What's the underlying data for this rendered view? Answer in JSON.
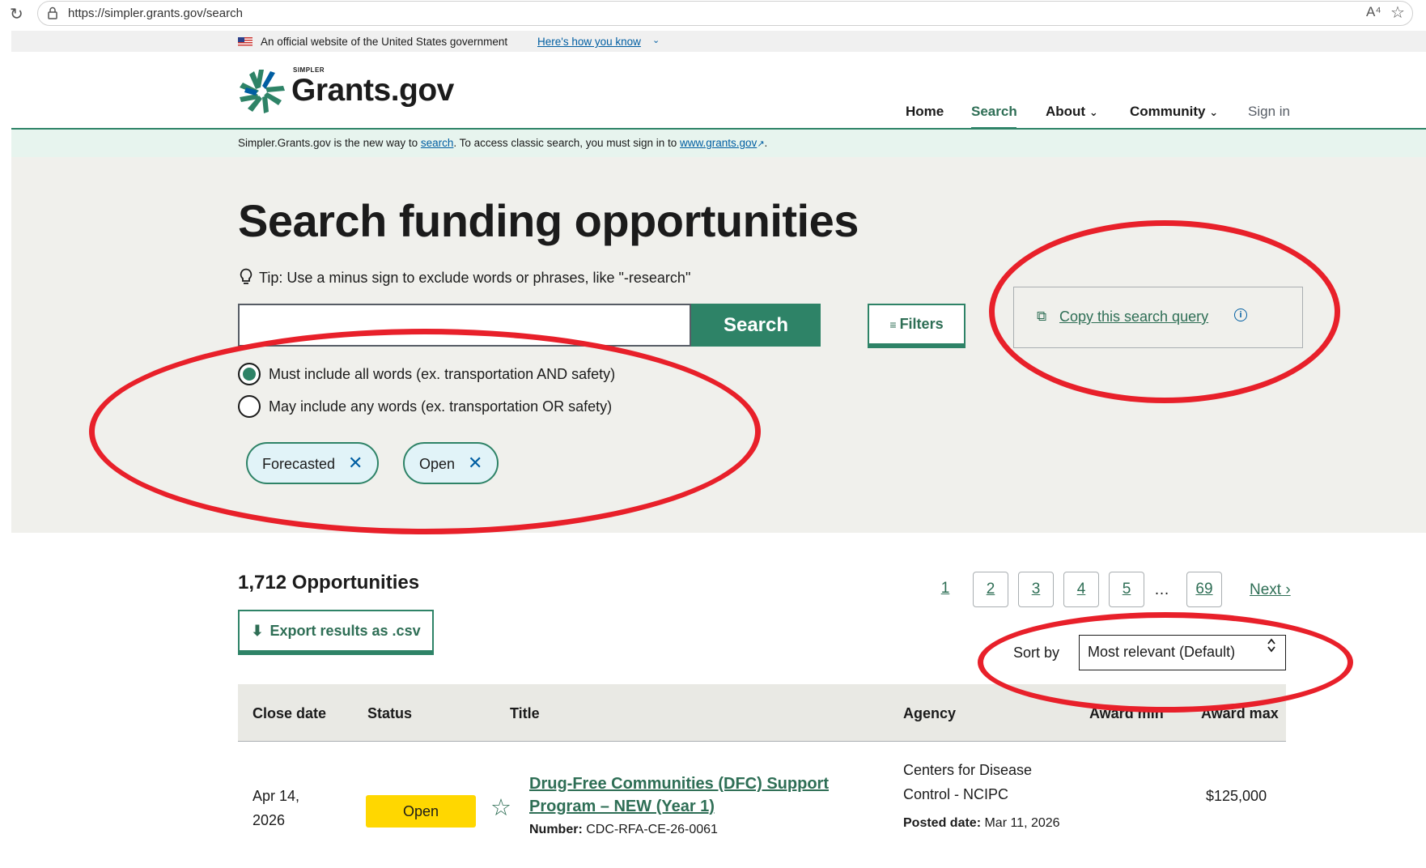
{
  "browser": {
    "url": "https://simpler.grants.gov/search",
    "reload_glyph": "↻",
    "read_aloud_glyph": "A⁴",
    "favorite_glyph": "☆"
  },
  "gov_banner": {
    "text": "An official website of the United States government",
    "link": "Here's how you know",
    "chevron": "⌄"
  },
  "header": {
    "logo_small": "SIMPLER",
    "logo_text": "Grants.gov",
    "nav": [
      "Home",
      "Search",
      "About",
      "Community",
      "Sign in"
    ],
    "active_nav": "Search",
    "dropdown_chevron": "⌄"
  },
  "alert": {
    "prefix": "Simpler.Grants.gov is the new way to ",
    "search_link": "search",
    "middle": ". To access classic search, you must sign in to ",
    "classic_link": "www.grants.gov",
    "external_glyph": "↗",
    "suffix": "."
  },
  "search": {
    "title": "Search funding opportunities",
    "tip_icon": "💡",
    "tip": "Tip: Use a minus sign to exclude words or phrases, like \"-research\"",
    "input_value": "",
    "button": "Search",
    "filters_icon": "≡",
    "filters_button": "Filters",
    "copy_icon": "⧉",
    "copy_link": "Copy this search query",
    "copy_info": "i",
    "radio_all": "Must include all words (ex. transportation AND safety)",
    "radio_any": "May include any words (ex. transportation OR safety)",
    "selected_radio": "all",
    "pills": [
      "Forecasted",
      "Open"
    ],
    "pill_remove": "✕"
  },
  "results": {
    "count": "1,712 Opportunities",
    "export_icon": "⬇",
    "export_button": "Export results as .csv",
    "pagination": [
      "1",
      "2",
      "3",
      "4",
      "5",
      "…",
      "69"
    ],
    "current_page": "1",
    "next": "Next ›",
    "sort_label": "Sort by",
    "sort_value": "Most relevant (Default)",
    "sort_arrows": "⌃⌄",
    "columns": [
      "Close date",
      "Status",
      "Title",
      "Agency",
      "Award min",
      "Award max"
    ],
    "rows": [
      {
        "close_date_1": "Apr 14,",
        "close_date_2": "2026",
        "status": "Open",
        "star_icon": "☆",
        "title": "Drug-Free Communities (DFC) Support Program – NEW (Year 1)",
        "number_label": "Number:",
        "number": "CDC-RFA-CE-26-0061",
        "agency": "Centers for Disease Control - NCIPC",
        "posted_label": "Posted date:",
        "posted": "Mar 11, 2026",
        "award_min": "",
        "award_max": "$125,000"
      }
    ]
  },
  "colors": {
    "primary_green": "#2e8367",
    "link_blue": "#005ea2",
    "status_open": "#ffd700",
    "annotation_red": "#e8202a",
    "search_bg": "#f0f0ec"
  }
}
